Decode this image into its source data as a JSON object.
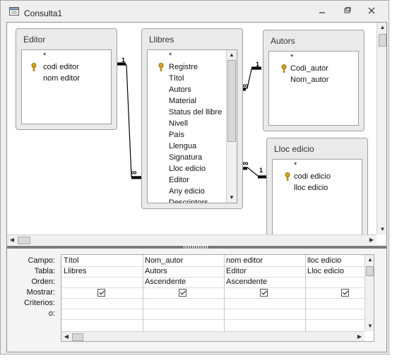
{
  "window": {
    "title": "Consulta1",
    "controls": [
      "minimize-icon",
      "restore-icon",
      "close-icon"
    ]
  },
  "tables": {
    "editor": {
      "title": "Editor",
      "fields": [
        "*",
        "codi editor",
        "nom editor"
      ],
      "key_field_index": 1
    },
    "llibres": {
      "title": "Llibres",
      "fields": [
        "*",
        "Registre",
        "Títol",
        "Autors",
        "Material",
        "Status del llibre",
        "Nivell",
        "País",
        "Llengua",
        "Signatura",
        "Lloc edicio",
        "Editor",
        "Any edicio",
        "Descriptors"
      ],
      "key_field_index": 1
    },
    "autors": {
      "title": "Autors",
      "fields": [
        "*",
        "Codi_autor",
        "Nom_autor"
      ],
      "key_field_index": 1
    },
    "lloc_edicio": {
      "title": "Lloc edicio",
      "fields": [
        "*",
        "codi edicio",
        "lloc edicio"
      ],
      "key_field_index": 1
    }
  },
  "relations": {
    "one_label": "1",
    "many_label": "∞"
  },
  "grid": {
    "row_labels": [
      "Campo:",
      "Tabla:",
      "Orden:",
      "Mostrar:",
      "Criterios:",
      "o:"
    ],
    "columns": [
      {
        "campo": "Títol",
        "tabla": "Llibres",
        "orden": "",
        "mostrar": true
      },
      {
        "campo": "Nom_autor",
        "tabla": "Autors",
        "orden": "Ascendente",
        "mostrar": true
      },
      {
        "campo": "nom editor",
        "tabla": "Editor",
        "orden": "Ascendente",
        "mostrar": true
      },
      {
        "campo": "lloc edicio",
        "tabla": "Lloc edicio",
        "orden": "",
        "mostrar": true
      }
    ]
  }
}
